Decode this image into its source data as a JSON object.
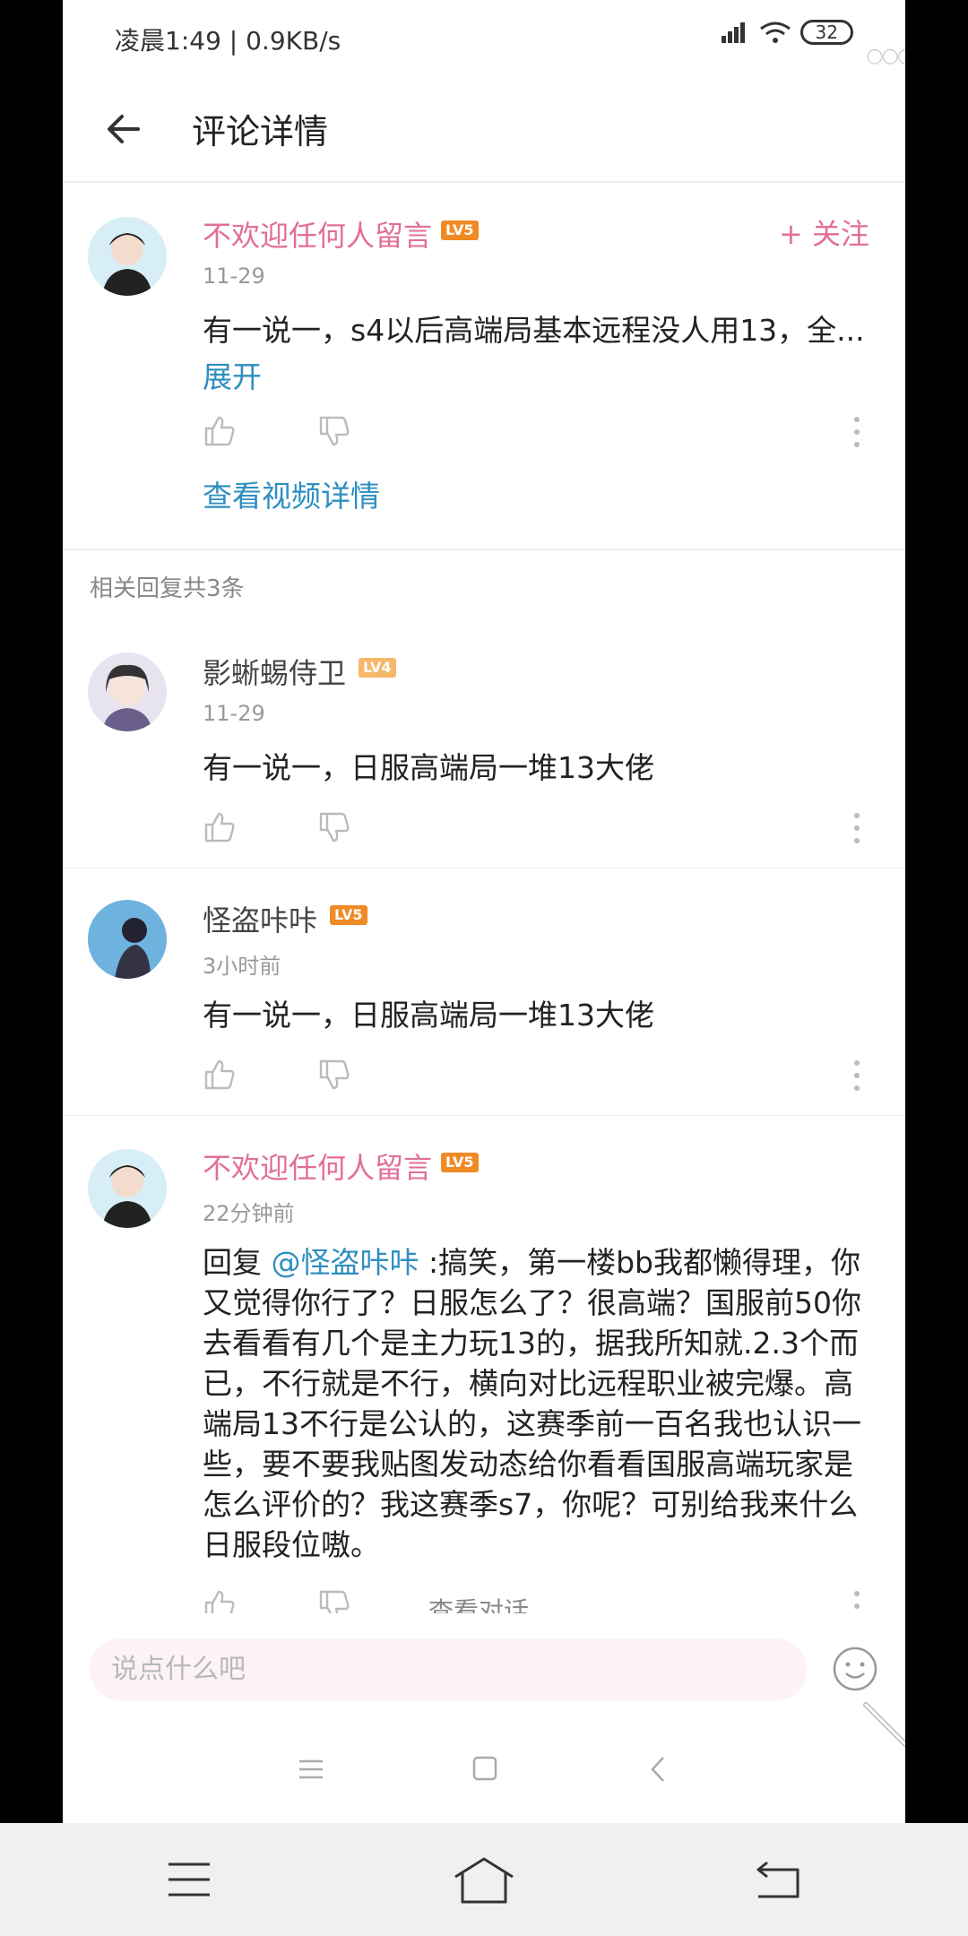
{
  "status": {
    "left_text": "凌晨1:49 | 0.9KB/s",
    "battery": "32"
  },
  "header": {
    "title": "评论详情"
  },
  "main_comment": {
    "user": "不欢迎任何人留言",
    "level": "LV5",
    "follow": "+ 关注",
    "time": "11-29",
    "content": "有一说一，s4以后高端局基本远程没人用13，全...",
    "expand": "展开",
    "video_link": "查看视频详情"
  },
  "replies_title": "相关回复共3条",
  "replies": [
    {
      "user": "影蜥蜴侍卫",
      "level": "LV4",
      "time": "11-29",
      "content": "有一说一，日服高端局一堆13大佬"
    },
    {
      "user": "怪盗咔咔",
      "level": "LV5",
      "time": "3小时前",
      "content": "有一说一，日服高端局一堆13大佬"
    },
    {
      "user": "不欢迎任何人留言",
      "level": "LV5",
      "time": "22分钟前",
      "reply_prefix": "回复 ",
      "mention": "@怪盗咔咔",
      "content": " :搞笑，第一楼bb我都懒得理，你又觉得你行了？日服怎么了？很高端？国服前50你去看看有几个是主力玩13的，据我所知就.2.3个而已，不行就是不行，横向对比远程职业被完爆。高端局13不行是公认的，这赛季前一百名我也认识一些，要不要我贴图发动态给你看看国服高端玩家是怎么评价的？我这赛季s7，你呢？可别给我来什么日服段位嗷。",
      "view_conversation": "查看对话"
    }
  ],
  "input": {
    "placeholder": "说点什么吧"
  },
  "colors": {
    "accent_pink": "#e26e9a",
    "link_blue": "#2e8ec0",
    "level_orange": "#f08a24"
  }
}
